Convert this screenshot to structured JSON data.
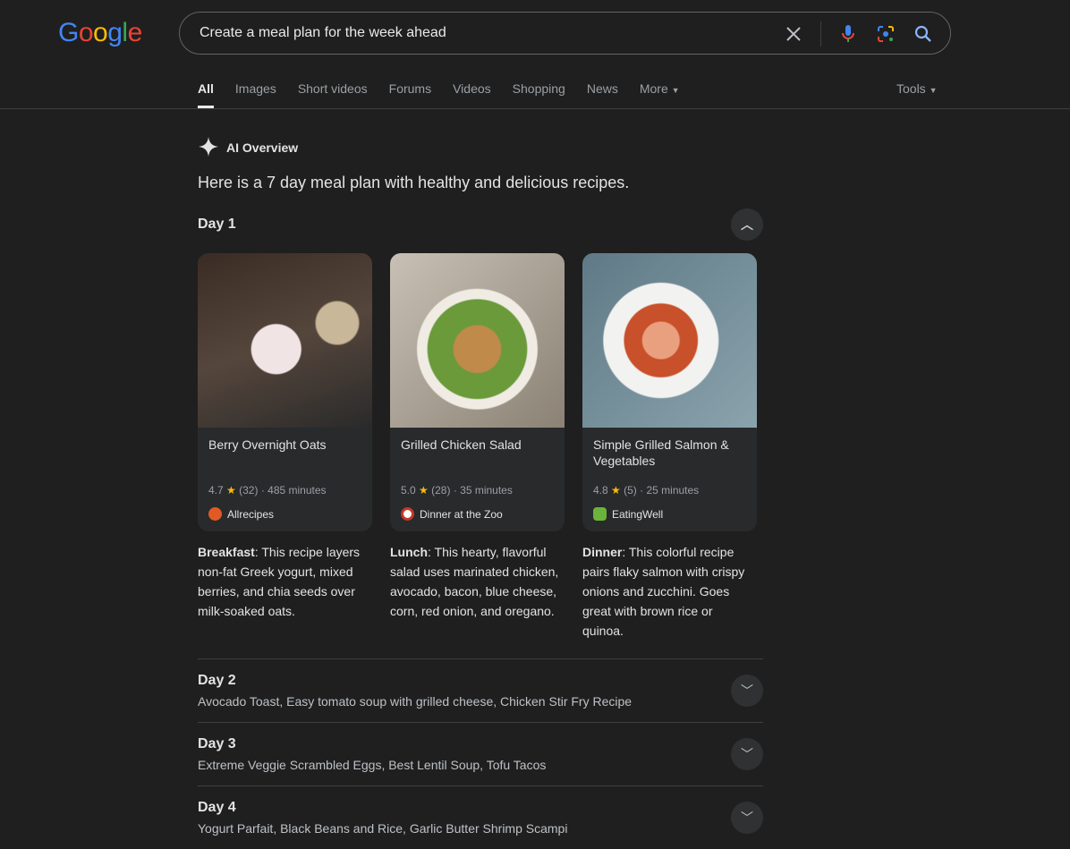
{
  "logo": "Google",
  "search": {
    "query": "Create a meal plan for the week ahead"
  },
  "tabs": [
    "All",
    "Images",
    "Short videos",
    "Forums",
    "Videos",
    "Shopping",
    "News",
    "More"
  ],
  "tools": "Tools",
  "overview": {
    "label": "AI Overview",
    "intro": "Here is a 7 day meal plan with healthy and delicious recipes.",
    "day1": {
      "title": "Day 1",
      "cards": [
        {
          "title": "Berry Overnight Oats",
          "rating": "4.7",
          "reviews": "(32)",
          "time": "485 minutes",
          "source": "Allrecipes",
          "meal": "Breakfast",
          "desc": ": This recipe layers non-fat Greek yogurt, mixed berries, and chia seeds over milk-soaked oats."
        },
        {
          "title": "Grilled Chicken Salad",
          "rating": "5.0",
          "reviews": "(28)",
          "time": "35 minutes",
          "source": "Dinner at the Zoo",
          "meal": "Lunch",
          "desc": ": This hearty, flavorful salad uses marinated chicken, avocado, bacon, blue cheese, corn, red onion, and oregano."
        },
        {
          "title": "Simple Grilled Salmon & Vegetables",
          "rating": "4.8",
          "reviews": "(5)",
          "time": "25 minutes",
          "source": "EatingWell",
          "meal": "Dinner",
          "desc": ": This colorful recipe pairs flaky salmon with crispy onions and zucchini. Goes great with brown rice or quinoa."
        }
      ]
    },
    "days": [
      {
        "title": "Day 2",
        "summary": "Avocado Toast, Easy tomato soup with grilled cheese, Chicken Stir Fry Recipe"
      },
      {
        "title": "Day 3",
        "summary": "Extreme Veggie Scrambled Eggs, Best Lentil Soup, Tofu Tacos"
      },
      {
        "title": "Day 4",
        "summary": "Yogurt Parfait, Black Beans and Rice, Garlic Butter Shrimp Scampi"
      }
    ]
  }
}
